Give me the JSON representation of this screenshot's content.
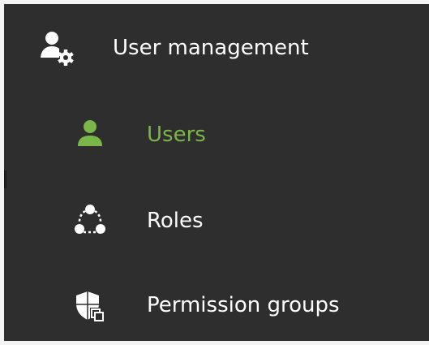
{
  "menu": {
    "header": {
      "label": "User management",
      "icon": "user-settings-icon"
    },
    "items": [
      {
        "label": "Users",
        "icon": "user-icon",
        "active": true
      },
      {
        "label": "Roles",
        "icon": "roles-icon",
        "active": false
      },
      {
        "label": "Permission groups",
        "icon": "permission-shield-icon",
        "active": false
      }
    ]
  },
  "colors": {
    "background": "#2e2e2e",
    "text": "#ffffff",
    "accent": "#7ab648"
  }
}
